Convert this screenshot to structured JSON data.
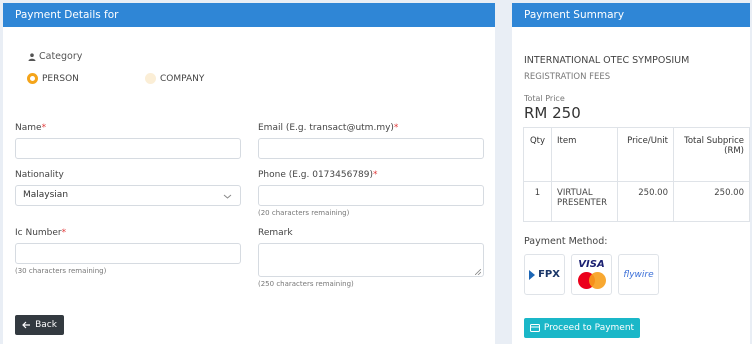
{
  "left": {
    "header": "Payment Details for",
    "category_label": "Category",
    "radios": [
      {
        "label": "PERSON",
        "checked": true
      },
      {
        "label": "COMPANY",
        "checked": false
      }
    ],
    "fields": {
      "name": {
        "label": "Name",
        "required": "*",
        "value": ""
      },
      "email": {
        "label": "Email (E.g. transact@utm.my)",
        "required": "*",
        "value": ""
      },
      "nationality": {
        "label": "Nationality",
        "value": "Malaysian"
      },
      "phone": {
        "label": "Phone (E.g. 0173456789)",
        "required": "*",
        "value": "",
        "hint": "(20 characters remaining)"
      },
      "ic": {
        "label": "Ic Number",
        "required": "*",
        "value": "",
        "hint": "(30 characters remaining)"
      },
      "remark": {
        "label": "Remark",
        "value": "",
        "hint": "(250 characters remaining)"
      }
    },
    "back_label": "Back"
  },
  "right": {
    "header": "Payment Summary",
    "title": "INTERNATIONAL OTEC SYMPOSIUM",
    "subtitle": "REGISTRATION FEES",
    "total_label": "Total Price",
    "total_amount": "RM 250",
    "table": {
      "headers": [
        "Qty",
        "Item",
        "Price/Unit",
        "Total Subprice (RM)"
      ],
      "rows": [
        [
          "1",
          "VIRTUAL PRESENTER",
          "250.00",
          "250.00"
        ]
      ]
    },
    "payment_method_label": "Payment Method:",
    "methods": {
      "fpx": "FPX",
      "visa": "VISA",
      "flywire": "flywire"
    },
    "proceed_label": "Proceed to Payment"
  },
  "colors": {
    "header_blue": "#2f86d6",
    "radio_orange": "#f4a41a",
    "proceed_teal": "#1ab7c8",
    "back_dark": "#333a40"
  }
}
